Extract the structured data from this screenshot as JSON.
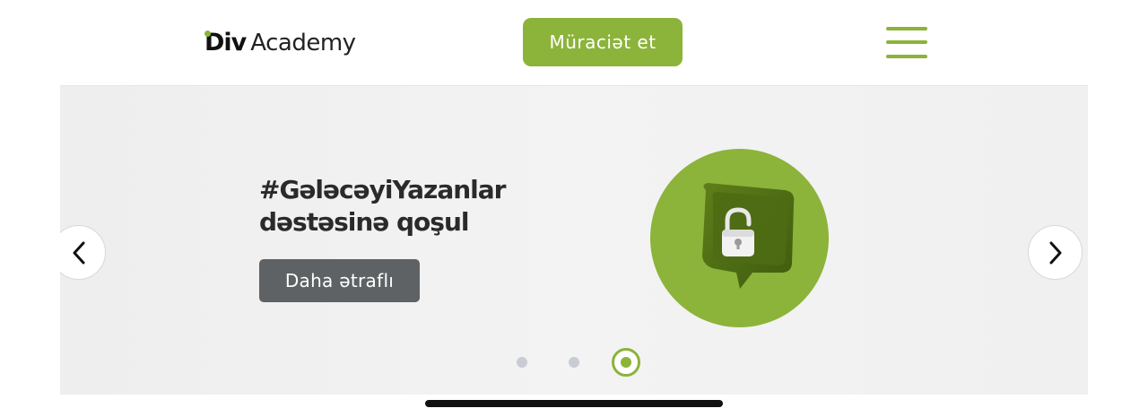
{
  "header": {
    "logo_mark": "Div",
    "logo_text": "Academy",
    "apply_label": "Müraciət et",
    "menu_icon": "hamburger-menu-icon"
  },
  "hero": {
    "title": "#GələcəyiYazanlar dəstəsinə qoşul",
    "button_label": "Daha ətraflı",
    "image_icon": "unlocked-padlock-chat-bubble-icon",
    "prev_icon": "chevron-left-icon",
    "next_icon": "chevron-right-icon",
    "slides_total": 3,
    "active_slide": 3
  },
  "colors": {
    "accent": "#8cb33a",
    "button_dark": "#5f6264",
    "dot_inactive": "#c9ccd4",
    "hero_bg": "#f0f0f0",
    "text_dark": "#2a2a2a"
  }
}
